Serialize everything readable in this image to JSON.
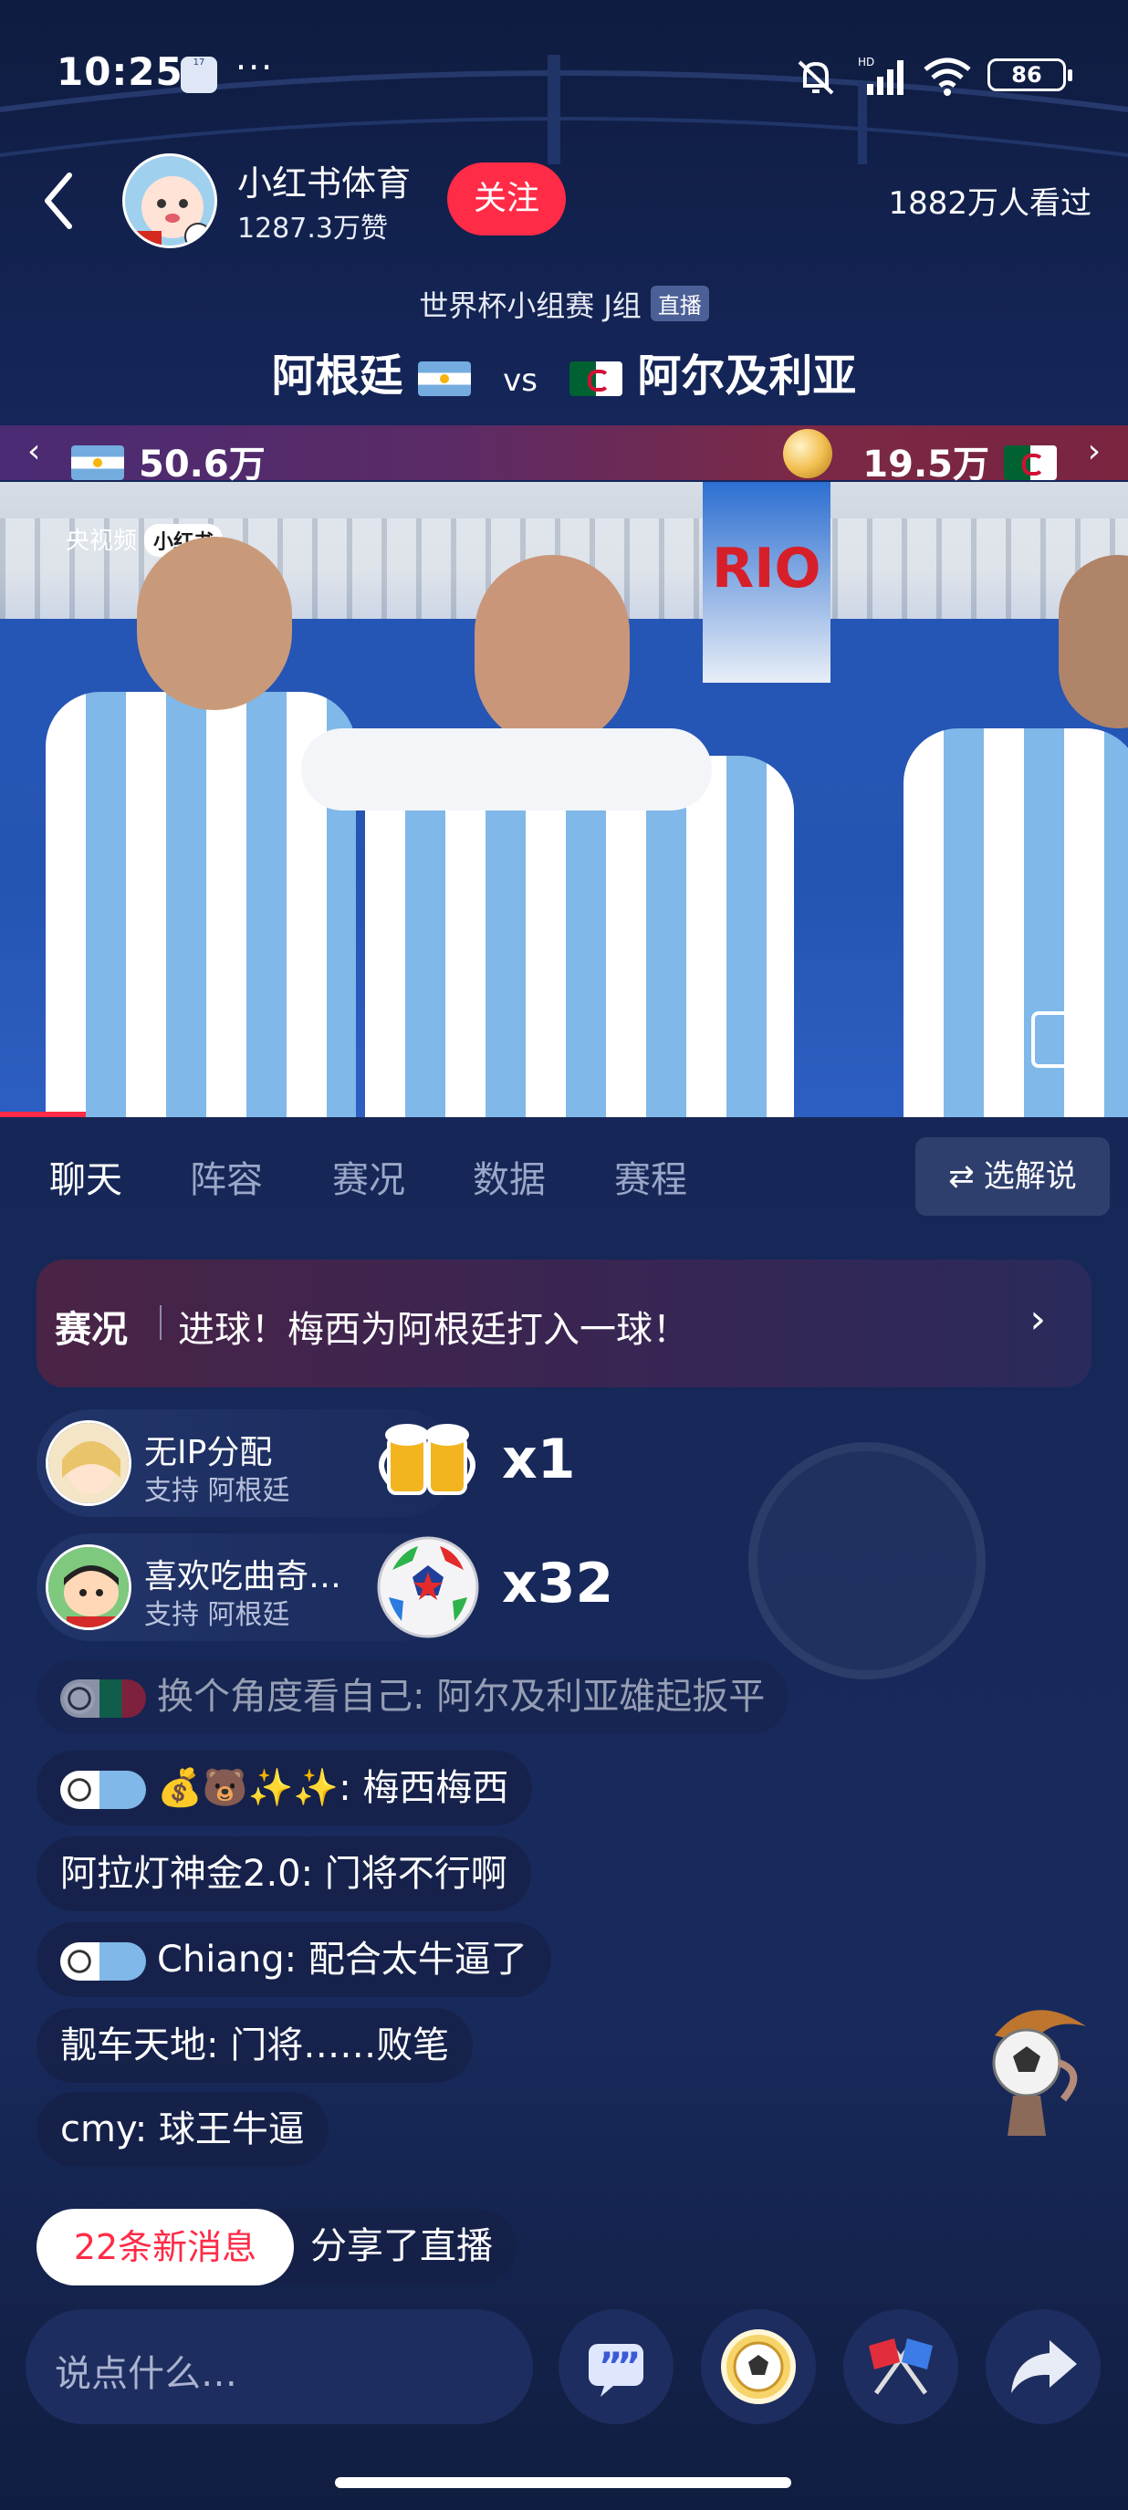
{
  "status_bar": {
    "time": "10:25",
    "calendar_day": "17",
    "battery": "86",
    "hd_label": "HD"
  },
  "header": {
    "channel_name": "小红书体育",
    "likes": "1287.3万赞",
    "follow_label": "关注",
    "viewers": "1882万人看过"
  },
  "match": {
    "round": "世界杯小组赛 J组",
    "live_badge": "直播",
    "home_team": "阿根廷",
    "vs": "vs",
    "away_team": "阿尔及利亚"
  },
  "support": {
    "home_count": "50.6万",
    "away_count": "19.5万"
  },
  "video": {
    "watermark": "央视频",
    "watermark_badge": "小红书",
    "banner_text": "RIO"
  },
  "tabs": [
    {
      "label": "聊天"
    },
    {
      "label": "阵容"
    },
    {
      "label": "赛况"
    },
    {
      "label": "数据"
    },
    {
      "label": "赛程"
    }
  ],
  "commentator_button": "选解说",
  "event": {
    "tag": "赛况",
    "text": "进球！梅西为阿根廷打入一球！"
  },
  "gifts": [
    {
      "user": "无IP分配",
      "support": "支持 阿根廷",
      "count": "x1",
      "icon": "beer-icon"
    },
    {
      "user": "喜欢吃曲奇…",
      "support": "支持 阿根廷",
      "count": "x32",
      "icon": "soccer-ball-icon"
    }
  ],
  "chat": [
    {
      "text": "换个角度看自己: 阿尔及利亚雄起扳平"
    },
    {
      "text": "💰🐻✨✨: 梅西梅西"
    },
    {
      "text": "阿拉灯神金2.0: 门将不行啊"
    },
    {
      "text": "Chiang: 配合太牛逼了"
    },
    {
      "text": "靓车天地: 门将……败笔"
    },
    {
      "text": "cmy: 球王牛逼"
    },
    {
      "text": "分享了直播"
    }
  ],
  "new_messages": "22条新消息",
  "input_placeholder": "说点什么…",
  "colors": {
    "accent": "#ff2b47",
    "background": "#172754",
    "argentina_blue": "#74acdf"
  }
}
